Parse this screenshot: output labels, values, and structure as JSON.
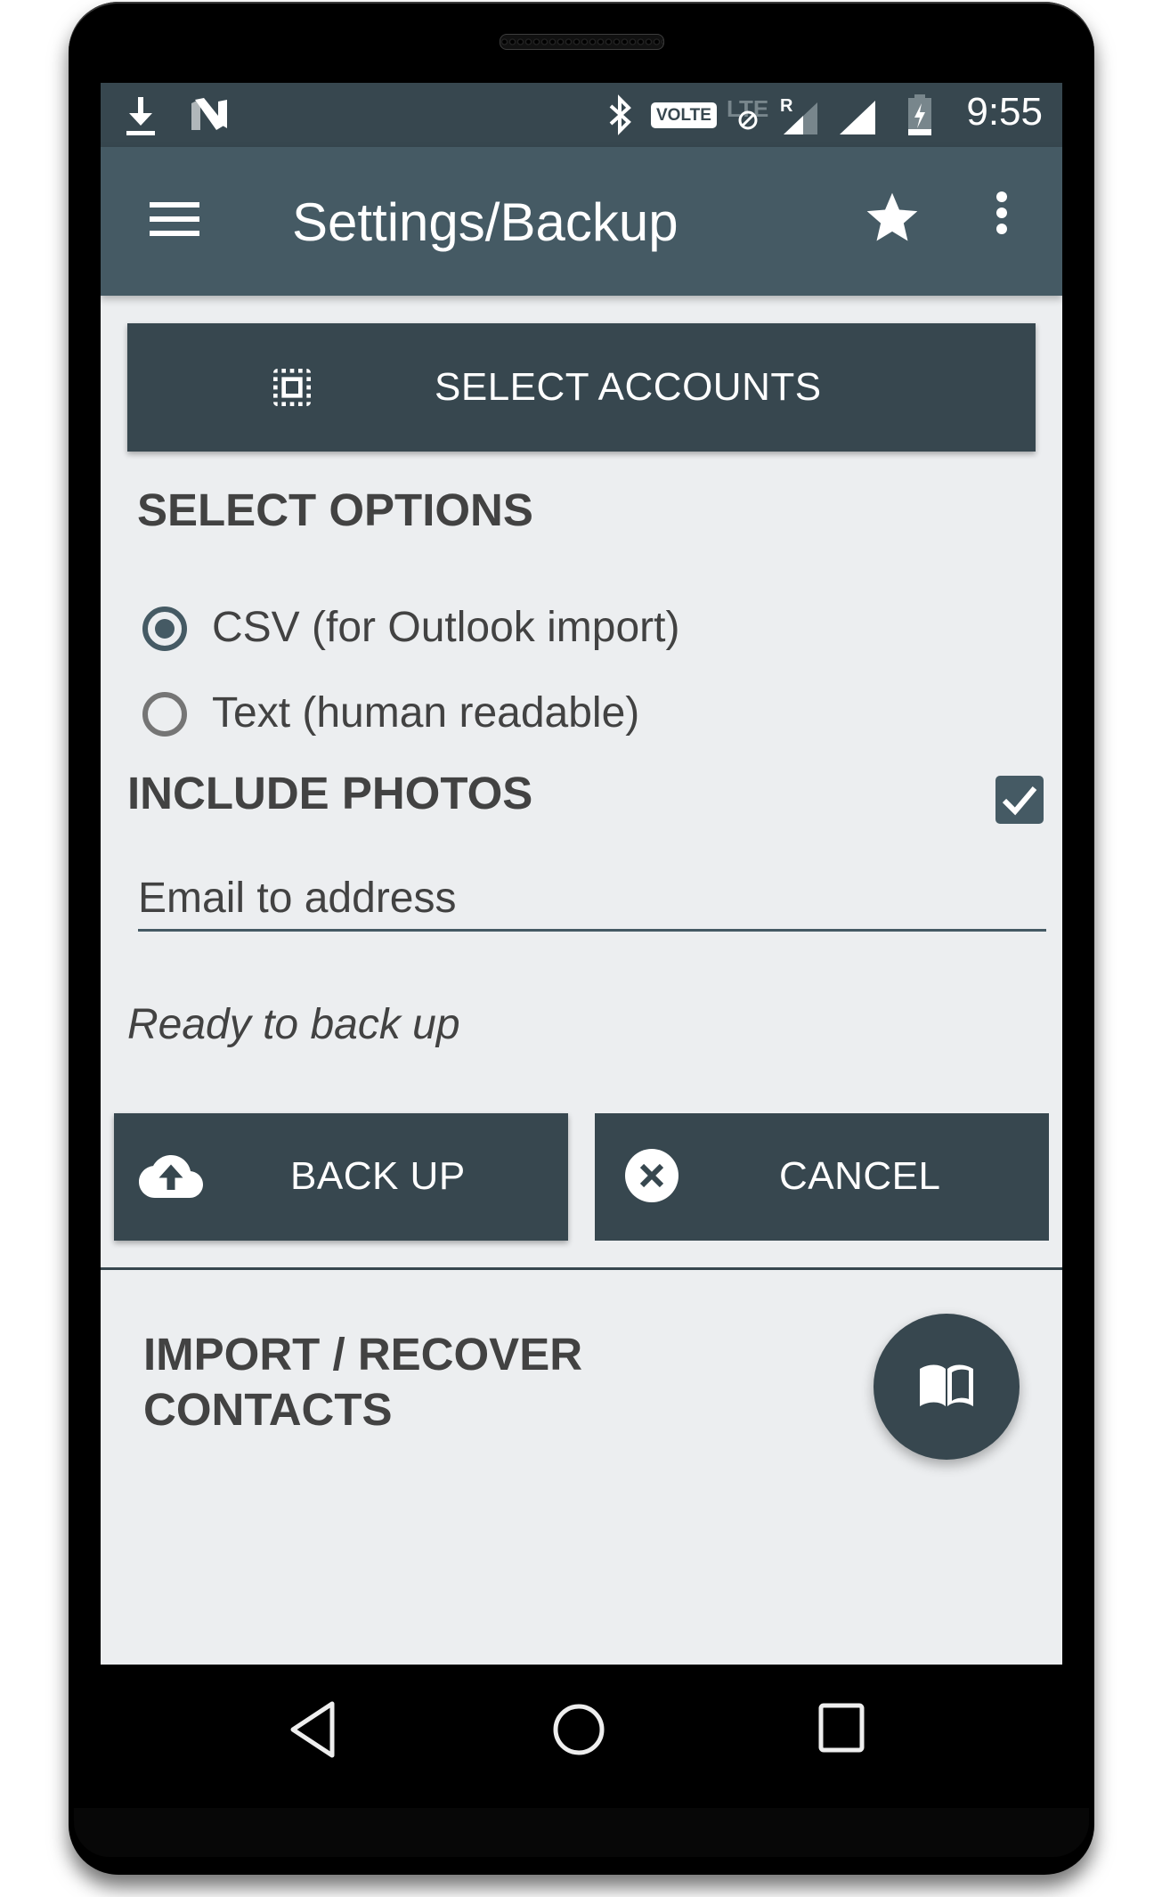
{
  "device": {
    "status_bar": {
      "time": "9:55",
      "left_icons": [
        "download-icon",
        "n-notification-icon"
      ],
      "right_icons": [
        "bluetooth-icon",
        "volte-icon",
        "lte-disabled-icon",
        "roaming-signal-icon",
        "signal-icon",
        "battery-charging-icon"
      ],
      "volte_label": "VOLTE",
      "lte_label": "LTE",
      "roaming_label": "R"
    },
    "nav_bar": {
      "buttons": [
        "back",
        "home",
        "recents"
      ]
    }
  },
  "app_bar": {
    "title": "Settings/Backup",
    "icons": [
      "menu-icon",
      "star-icon",
      "more-vert-icon"
    ]
  },
  "select_accounts": {
    "label": "SELECT ACCOUNTS",
    "icon": "select-all-icon"
  },
  "options": {
    "title": "SELECT OPTIONS",
    "format_options": [
      {
        "label": "CSV (for Outlook import)",
        "selected": true
      },
      {
        "label": "Text (human readable)",
        "selected": false
      }
    ]
  },
  "include_photos": {
    "label": "INCLUDE PHOTOS",
    "checked": true
  },
  "email": {
    "placeholder": "Email to address",
    "value": ""
  },
  "status": {
    "text": "Ready to back up"
  },
  "actions": {
    "backup_label": "BACK UP",
    "backup_icon": "cloud-upload-icon",
    "cancel_label": "CANCEL",
    "cancel_icon": "cancel-circle-icon"
  },
  "import": {
    "title_line1": "IMPORT / RECOVER",
    "title_line2": "CONTACTS",
    "fab_icon": "book-open-icon"
  },
  "colors": {
    "status_bar": "#37474f",
    "app_bar": "#455a64",
    "button": "#37474f",
    "background": "#eceef0",
    "text": "#424242"
  }
}
